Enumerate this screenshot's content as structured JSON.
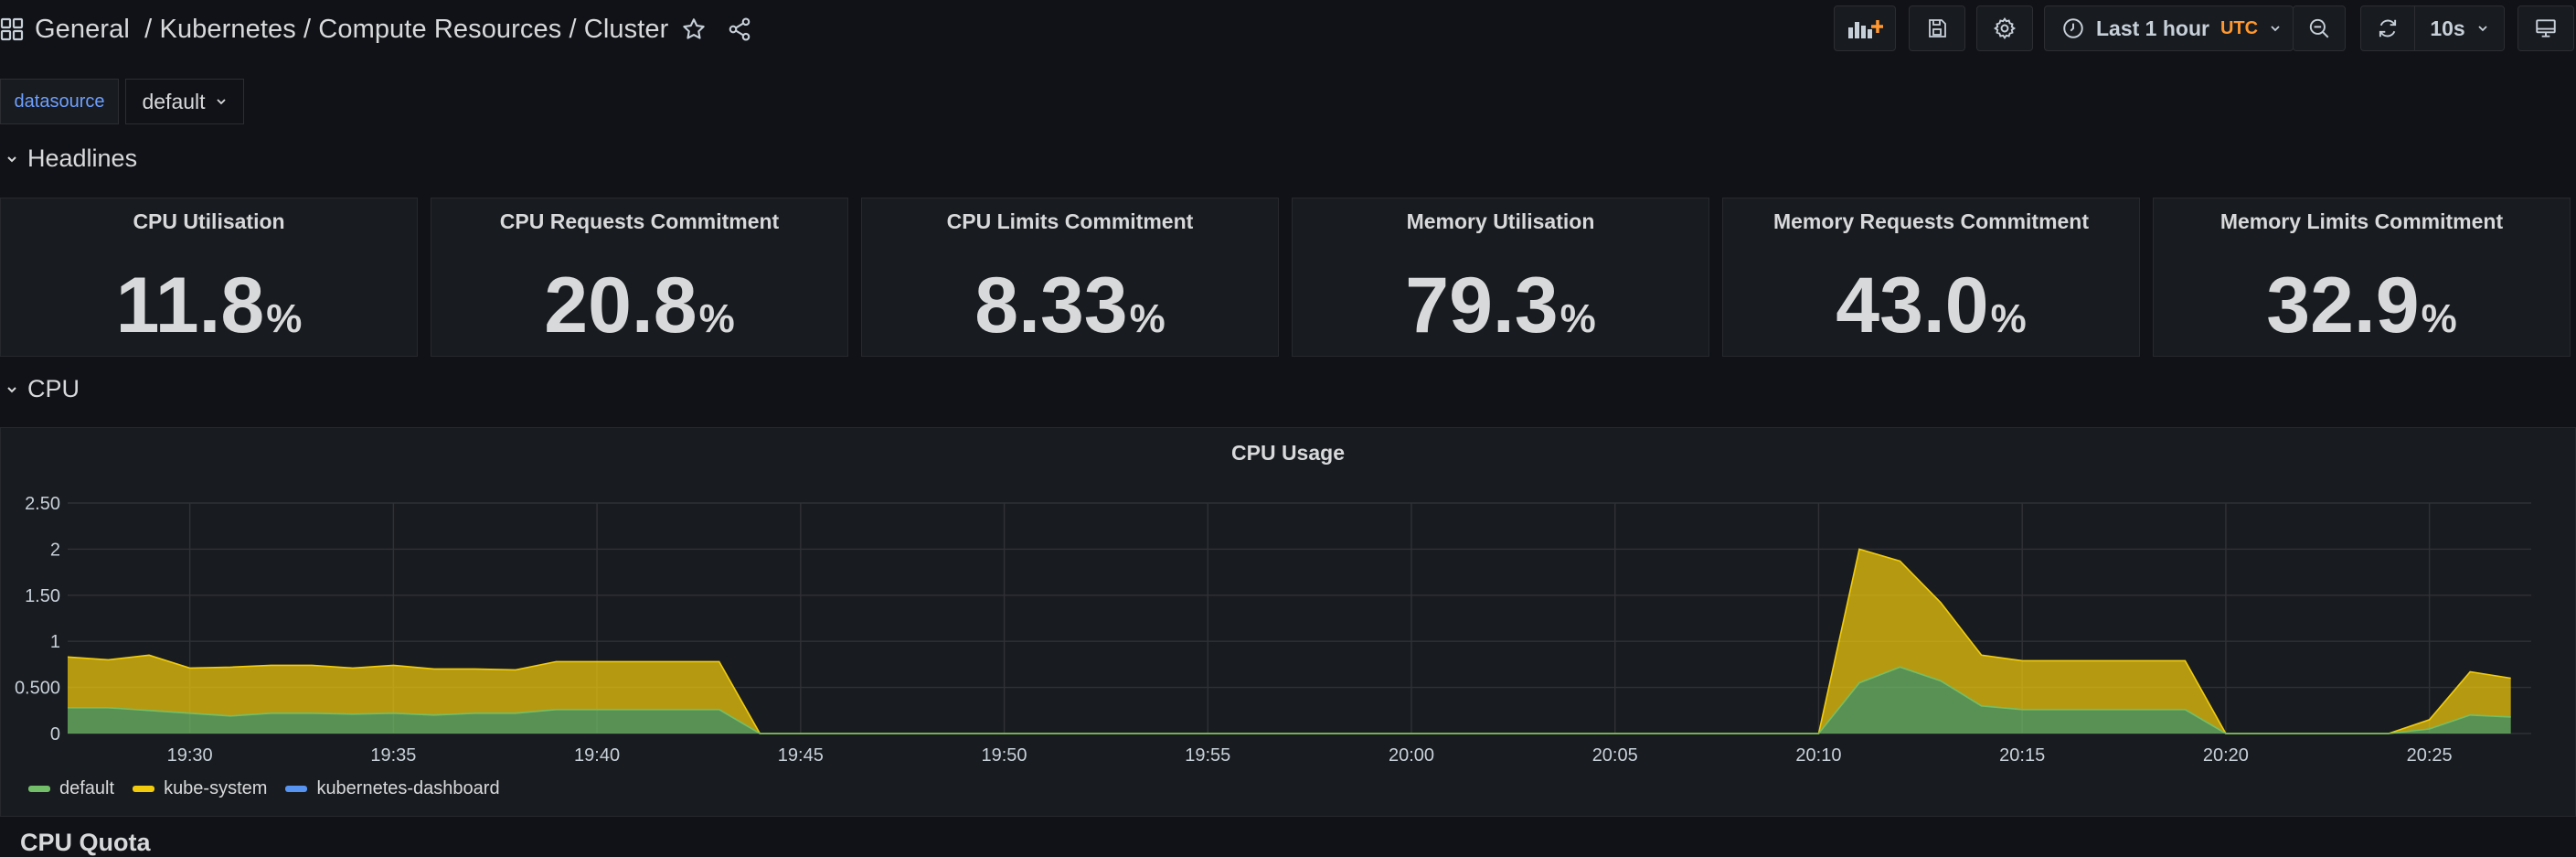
{
  "header": {
    "breadcrumb": "General  / Kubernetes / Compute Resources / Cluster",
    "time_range": "Last 1 hour",
    "timezone": "UTC",
    "refresh_interval": "10s",
    "icons": {
      "apps": "grid-icon",
      "star": "star-icon",
      "share": "share-icon",
      "add_panel": "add-panel-icon",
      "save": "save-icon",
      "settings": "gear-icon",
      "clock": "clock-icon",
      "zoom_out": "zoom-out-icon",
      "refresh": "refresh-icon",
      "tv": "tv-icon"
    }
  },
  "variables": {
    "datasource_label": "datasource",
    "datasource_value": "default"
  },
  "rows": {
    "headlines": "Headlines",
    "cpu": "CPU",
    "next_partial": "CPU Quota"
  },
  "stats": [
    {
      "title": "CPU Utilisation",
      "value": "11.8",
      "unit": "%"
    },
    {
      "title": "CPU Requests Commitment",
      "value": "20.8",
      "unit": "%"
    },
    {
      "title": "CPU Limits Commitment",
      "value": "8.33",
      "unit": "%"
    },
    {
      "title": "Memory Utilisation",
      "value": "79.3",
      "unit": "%"
    },
    {
      "title": "Memory Requests Commitment",
      "value": "43.0",
      "unit": "%"
    },
    {
      "title": "Memory Limits Commitment",
      "value": "32.9",
      "unit": "%"
    }
  ],
  "colors": {
    "background": "#111217",
    "panel": "#181b1f",
    "accent_blue": "#6e9fff",
    "utc_orange": "#ff9830",
    "default_series": "#73bf69",
    "kube_system_series": "#f2cc0c",
    "dashboard_series": "#5794f2"
  },
  "chart_data": {
    "type": "area",
    "title": "CPU Usage",
    "x_tick_labels": [
      "19:30",
      "19:35",
      "19:40",
      "19:45",
      "19:50",
      "19:55",
      "20:00",
      "20:05",
      "20:10",
      "20:15",
      "20:20",
      "20:25"
    ],
    "y_tick_labels": [
      "0",
      "0.500",
      "1",
      "1.50",
      "2",
      "2.50"
    ],
    "ylim": [
      0,
      2.5
    ],
    "stacked": true,
    "grid": true,
    "legend_placement": "bottom-left",
    "x": [
      "19:27",
      "19:28",
      "19:29",
      "19:30",
      "19:31",
      "19:32",
      "19:33",
      "19:34",
      "19:35",
      "19:36",
      "19:37",
      "19:38",
      "19:39",
      "19:40",
      "19:41",
      "19:42",
      "19:43",
      "19:44",
      "19:45",
      "19:46",
      "19:47",
      "19:48",
      "19:49",
      "19:50",
      "19:51",
      "19:52",
      "19:53",
      "19:54",
      "19:55",
      "19:56",
      "19:57",
      "19:58",
      "19:59",
      "20:00",
      "20:01",
      "20:02",
      "20:03",
      "20:04",
      "20:05",
      "20:06",
      "20:07",
      "20:08",
      "20:09",
      "20:10",
      "20:11",
      "20:12",
      "20:13",
      "20:14",
      "20:15",
      "20:16",
      "20:17",
      "20:18",
      "20:19",
      "20:20",
      "20:21",
      "20:22",
      "20:23",
      "20:24",
      "20:25",
      "20:26",
      "20:27"
    ],
    "series": [
      {
        "name": "default",
        "color": "#73bf69",
        "values": [
          0.28,
          0.28,
          0.25,
          0.22,
          0.19,
          0.22,
          0.22,
          0.21,
          0.22,
          0.2,
          0.22,
          0.22,
          0.26,
          0.26,
          0.26,
          0.26,
          0.26,
          0,
          0,
          0,
          0,
          0,
          0,
          0,
          0,
          0,
          0,
          0,
          0,
          0,
          0,
          0,
          0,
          0,
          0,
          0,
          0,
          0,
          0,
          0,
          0,
          0,
          0,
          0,
          0.55,
          0.72,
          0.57,
          0.3,
          0.26,
          0.26,
          0.26,
          0.26,
          0.26,
          0,
          0,
          0,
          0,
          0,
          0.05,
          0.2,
          0.18
        ]
      },
      {
        "name": "kube-system",
        "color": "#f2cc0c",
        "values": [
          0.55,
          0.52,
          0.6,
          0.49,
          0.53,
          0.52,
          0.52,
          0.5,
          0.52,
          0.5,
          0.48,
          0.47,
          0.52,
          0.52,
          0.52,
          0.52,
          0.52,
          0,
          0,
          0,
          0,
          0,
          0,
          0,
          0,
          0,
          0,
          0,
          0,
          0,
          0,
          0,
          0,
          0,
          0,
          0,
          0,
          0,
          0,
          0,
          0,
          0,
          0,
          0,
          1.45,
          1.15,
          0.85,
          0.55,
          0.53,
          0.53,
          0.53,
          0.53,
          0.53,
          0,
          0,
          0,
          0,
          0,
          0.1,
          0.47,
          0.42
        ]
      },
      {
        "name": "kubernetes-dashboard",
        "color": "#5794f2",
        "values": [
          0,
          0,
          0,
          0,
          0,
          0,
          0,
          0,
          0,
          0,
          0,
          0,
          0,
          0,
          0,
          0,
          0,
          0,
          0,
          0,
          0,
          0,
          0,
          0,
          0,
          0,
          0,
          0,
          0,
          0,
          0,
          0,
          0,
          0,
          0,
          0,
          0,
          0,
          0,
          0,
          0,
          0,
          0,
          0,
          0,
          0,
          0,
          0,
          0,
          0,
          0,
          0,
          0,
          0,
          0,
          0,
          0,
          0,
          0,
          0,
          0
        ]
      }
    ]
  }
}
